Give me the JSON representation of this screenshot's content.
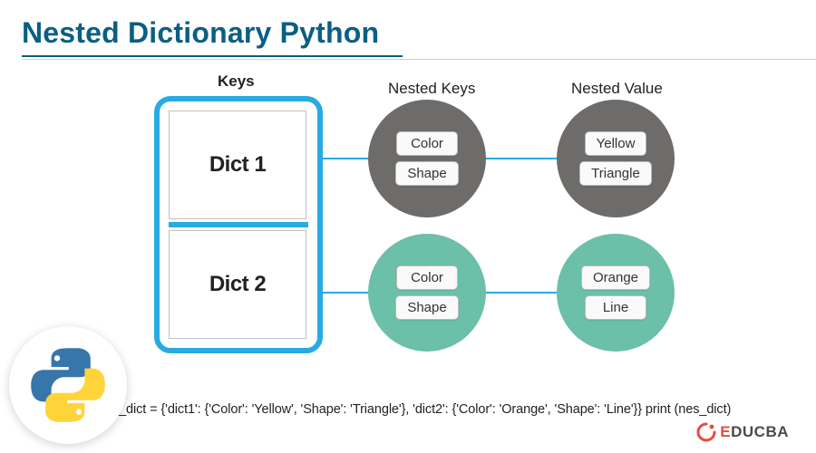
{
  "header": {
    "title": "Nested Dictionary Python"
  },
  "columns": {
    "keys": "Keys",
    "nested_keys": "Nested Keys",
    "nested_value": "Nested Value"
  },
  "outer": {
    "dict1_label": "Dict 1",
    "dict2_label": "Dict 2"
  },
  "nested_keys": {
    "row1": [
      "Color",
      "Shape"
    ],
    "row2": [
      "Color",
      "Shape"
    ]
  },
  "nested_values": {
    "row1": [
      "Yellow",
      "Triangle"
    ],
    "row2": [
      "Orange",
      "Line"
    ]
  },
  "code": "nes_dict = {'dict1': {'Color': 'Yellow', 'Shape': 'Triangle'}, 'dict2': {'Color': 'Orange', 'Shape': 'Line'}} print (nes_dict)",
  "brand": {
    "name": "EDUCBA",
    "accent": "E",
    "rest": "DUCBA"
  },
  "colors": {
    "primary": "#0b5e84",
    "connector": "#29abe2",
    "gray_circle": "#6d6c6a",
    "teal_circle": "#6cbfa8"
  },
  "chart_data": {
    "type": "table",
    "title": "Nested Dictionary Python",
    "rows": [
      {
        "key": "dict1",
        "nested": {
          "Color": "Yellow",
          "Shape": "Triangle"
        }
      },
      {
        "key": "dict2",
        "nested": {
          "Color": "Orange",
          "Shape": "Line"
        }
      }
    ]
  }
}
